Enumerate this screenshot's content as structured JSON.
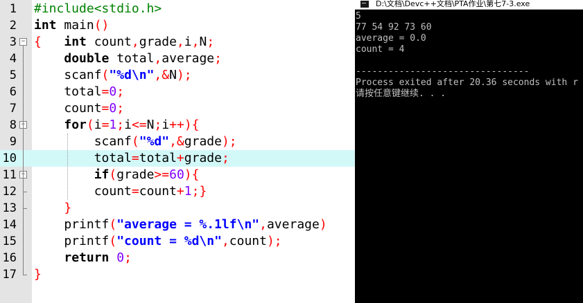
{
  "editor": {
    "lines": [
      {
        "n": "1",
        "tokens": [
          {
            "t": "#include<stdio.h>",
            "c": "pp"
          }
        ]
      },
      {
        "n": "2",
        "tokens": [
          {
            "t": "int",
            "c": "kw"
          },
          {
            "t": " main",
            "c": ""
          },
          {
            "t": "()",
            "c": "sym"
          }
        ]
      },
      {
        "n": "3",
        "tokens": [
          {
            "t": "{",
            "c": "sym"
          },
          {
            "t": "   ",
            "c": ""
          },
          {
            "t": "int",
            "c": "kw"
          },
          {
            "t": " count",
            "c": ""
          },
          {
            "t": ",",
            "c": "sym"
          },
          {
            "t": "grade",
            "c": ""
          },
          {
            "t": ",",
            "c": "sym"
          },
          {
            "t": "i",
            "c": ""
          },
          {
            "t": ",",
            "c": "sym"
          },
          {
            "t": "N",
            "c": ""
          },
          {
            "t": ";",
            "c": "sym"
          }
        ]
      },
      {
        "n": "4",
        "tokens": [
          {
            "t": "    ",
            "c": ""
          },
          {
            "t": "double",
            "c": "kw"
          },
          {
            "t": " total",
            "c": ""
          },
          {
            "t": ",",
            "c": "sym"
          },
          {
            "t": "average",
            "c": ""
          },
          {
            "t": ";",
            "c": "sym"
          }
        ]
      },
      {
        "n": "5",
        "tokens": [
          {
            "t": "    scanf",
            "c": ""
          },
          {
            "t": "(",
            "c": "sym"
          },
          {
            "t": "\"%d\\n\"",
            "c": "str"
          },
          {
            "t": ",&",
            "c": "sym"
          },
          {
            "t": "N",
            "c": ""
          },
          {
            "t": ");",
            "c": "sym"
          }
        ]
      },
      {
        "n": "6",
        "tokens": [
          {
            "t": "    total",
            "c": ""
          },
          {
            "t": "=",
            "c": "sym"
          },
          {
            "t": "0",
            "c": "num"
          },
          {
            "t": ";",
            "c": "sym"
          }
        ]
      },
      {
        "n": "7",
        "tokens": [
          {
            "t": "    count",
            "c": ""
          },
          {
            "t": "=",
            "c": "sym"
          },
          {
            "t": "0",
            "c": "num"
          },
          {
            "t": ";",
            "c": "sym"
          }
        ]
      },
      {
        "n": "8",
        "tokens": [
          {
            "t": "    ",
            "c": ""
          },
          {
            "t": "for",
            "c": "kw"
          },
          {
            "t": "(",
            "c": "sym"
          },
          {
            "t": "i",
            "c": ""
          },
          {
            "t": "=",
            "c": "sym"
          },
          {
            "t": "1",
            "c": "num"
          },
          {
            "t": ";",
            "c": "sym"
          },
          {
            "t": "i",
            "c": ""
          },
          {
            "t": "<=",
            "c": "sym"
          },
          {
            "t": "N",
            "c": ""
          },
          {
            "t": ";",
            "c": "sym"
          },
          {
            "t": "i",
            "c": ""
          },
          {
            "t": "++){",
            "c": "sym"
          }
        ]
      },
      {
        "n": "9",
        "tokens": [
          {
            "t": "        scanf",
            "c": ""
          },
          {
            "t": "(",
            "c": "sym"
          },
          {
            "t": "\"%d\"",
            "c": "str"
          },
          {
            "t": ",&",
            "c": "sym"
          },
          {
            "t": "grade",
            "c": ""
          },
          {
            "t": ");",
            "c": "sym"
          }
        ]
      },
      {
        "n": "10",
        "tokens": [
          {
            "t": "        total",
            "c": ""
          },
          {
            "t": "=",
            "c": "sym"
          },
          {
            "t": "total",
            "c": ""
          },
          {
            "t": "+",
            "c": "sym"
          },
          {
            "t": "grade",
            "c": ""
          },
          {
            "t": ";",
            "c": "sym"
          }
        ]
      },
      {
        "n": "11",
        "tokens": [
          {
            "t": "        ",
            "c": ""
          },
          {
            "t": "if",
            "c": "kw"
          },
          {
            "t": "(",
            "c": "sym"
          },
          {
            "t": "grade",
            "c": ""
          },
          {
            "t": ">=",
            "c": "sym"
          },
          {
            "t": "60",
            "c": "num"
          },
          {
            "t": "){",
            "c": "sym"
          }
        ]
      },
      {
        "n": "12",
        "tokens": [
          {
            "t": "        count",
            "c": ""
          },
          {
            "t": "=",
            "c": "sym"
          },
          {
            "t": "count",
            "c": ""
          },
          {
            "t": "+",
            "c": "sym"
          },
          {
            "t": "1",
            "c": "num"
          },
          {
            "t": ";}",
            "c": "sym"
          }
        ]
      },
      {
        "n": "13",
        "tokens": [
          {
            "t": "    ",
            "c": ""
          },
          {
            "t": "}",
            "c": "sym"
          }
        ]
      },
      {
        "n": "14",
        "tokens": [
          {
            "t": "    printf",
            "c": ""
          },
          {
            "t": "(",
            "c": "sym"
          },
          {
            "t": "\"average = %.1lf\\n\"",
            "c": "str"
          },
          {
            "t": ",",
            "c": "sym"
          },
          {
            "t": "average",
            "c": ""
          },
          {
            "t": ")",
            "c": "sym"
          }
        ]
      },
      {
        "n": "15",
        "tokens": [
          {
            "t": "    printf",
            "c": ""
          },
          {
            "t": "(",
            "c": "sym"
          },
          {
            "t": "\"count = %d\\n\"",
            "c": "str"
          },
          {
            "t": ",",
            "c": "sym"
          },
          {
            "t": "count",
            "c": ""
          },
          {
            "t": ");",
            "c": "sym"
          }
        ]
      },
      {
        "n": "16",
        "tokens": [
          {
            "t": "    ",
            "c": ""
          },
          {
            "t": "return",
            "c": "kw"
          },
          {
            "t": " ",
            "c": ""
          },
          {
            "t": "0",
            "c": "num"
          },
          {
            "t": ";",
            "c": "sym"
          }
        ]
      },
      {
        "n": "17",
        "tokens": [
          {
            "t": "}",
            "c": "sym"
          }
        ]
      }
    ],
    "highlighted_line": "10",
    "fold_lines": [
      "3",
      "8",
      "11"
    ]
  },
  "console": {
    "title": "D:\\文档\\Devc++文档\\PTA作业\\第七7-3.exe",
    "lines": [
      "5",
      "77 54 92 73 60",
      "average = 0.0",
      "count = 4",
      "",
      "--------------------------------",
      "Process exited after 20.36 seconds with r",
      "请按任意键继续. . ."
    ]
  },
  "colors": {
    "keyword": "#000000",
    "preprocessor": "#008000",
    "symbol": "#ff0000",
    "string": "#0000ff",
    "number": "#8000ff",
    "highlight": "#d3f8f8",
    "gutter": "#e4e4e4",
    "console_bg": "#000000",
    "console_text": "#c0c0c0"
  }
}
